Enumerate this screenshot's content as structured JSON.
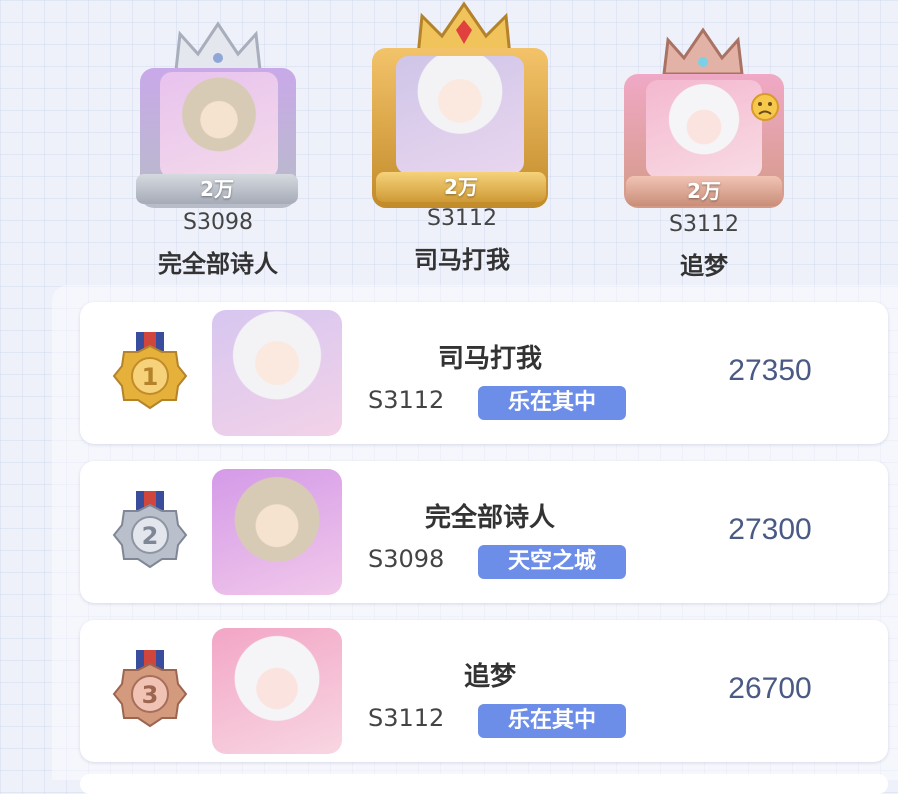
{
  "podium": [
    {
      "rank": 2,
      "badge": "2万",
      "server": "S3098",
      "name": "完全部诗人",
      "crown": "silver-crown-icon",
      "frame_color": "#b7bcc8"
    },
    {
      "rank": 1,
      "badge": "2万",
      "server": "S3112",
      "name": "司马打我",
      "crown": "gold-crown-icon",
      "frame_color": "#d9a84a"
    },
    {
      "rank": 3,
      "badge": "2万",
      "server": "S3112",
      "name": "追梦",
      "crown": "bronze-crown-icon",
      "frame_color": "#d49a86"
    }
  ],
  "ranking": [
    {
      "rank": "1",
      "name": "司马打我",
      "server": "S3112",
      "tag": "乐在其中",
      "score": "27350",
      "medal_color": "#e5b13a"
    },
    {
      "rank": "2",
      "name": "完全部诗人",
      "server": "S3098",
      "tag": "天空之城",
      "score": "27300",
      "medal_color": "#b9c0cc"
    },
    {
      "rank": "3",
      "name": "追梦",
      "server": "S3112",
      "tag": "乐在其中",
      "score": "26700",
      "medal_color": "#d49a7e"
    }
  ]
}
